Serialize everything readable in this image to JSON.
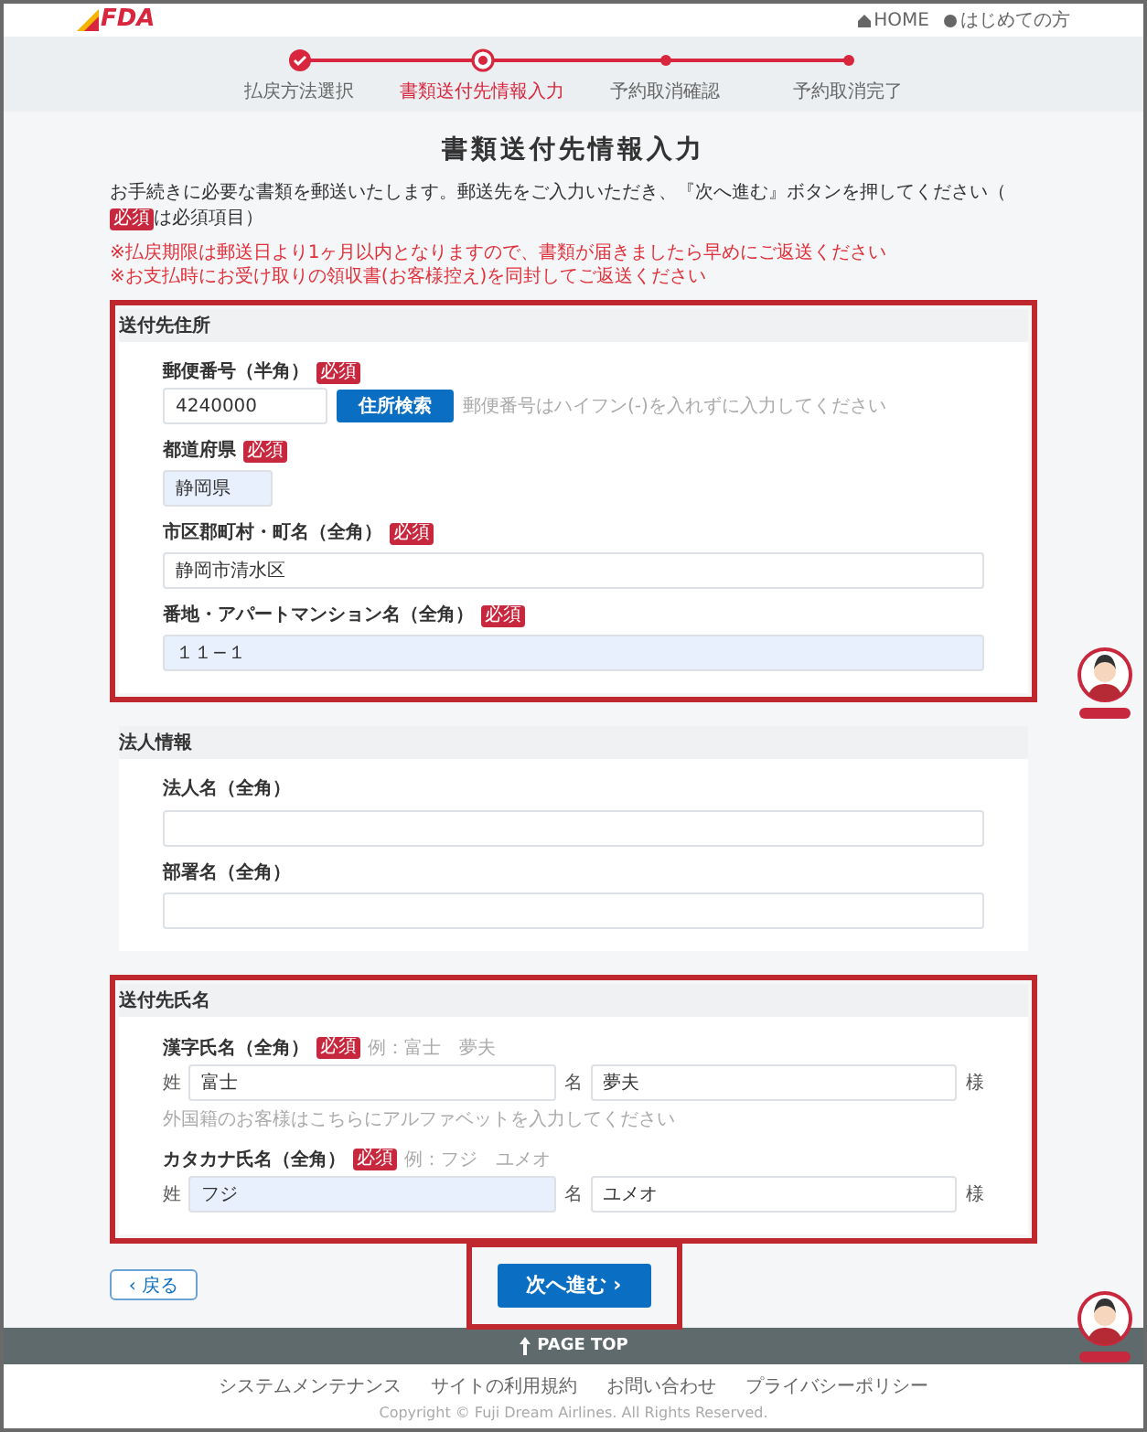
{
  "header": {
    "logo": "FDA",
    "links": [
      {
        "kind": "home",
        "label": "HOME"
      },
      {
        "kind": "guide",
        "label": "はじめての方"
      }
    ]
  },
  "steps": [
    {
      "label": "払戻方法選択",
      "completed": true,
      "selected": false
    },
    {
      "label": "書類送付先情報入力",
      "completed": false,
      "selected": true
    },
    {
      "label": "予約取消確認",
      "completed": false,
      "selected": false
    },
    {
      "label": "予約取消完了",
      "completed": false,
      "selected": false
    }
  ],
  "title": "書類送付先情報入力",
  "intro": {
    "before": "お手続きに必要な書類を郵送いたします。郵送先をご入力いただき、『次へ進む』ボタンを押してください（",
    "badge": "必須",
    "after": "は必須項目）"
  },
  "notes": [
    "※払戻期限は郵送日より1ヶ月以内となりますので、書類が届きましたら早めにご返送ください",
    "※お支払時にお受け取りの領収書(お客様控え)を同封してご返送ください"
  ],
  "sections": [
    {
      "title": "送付先住所",
      "highlighted": true,
      "fields": [
        {
          "kind": "postal",
          "label": "郵便番号（半角）",
          "required": "必須",
          "value": "4240000",
          "autofilled": false,
          "button": "住所検索",
          "hint": "郵便番号はハイフン(-)を入れずに入力してください"
        },
        {
          "kind": "short",
          "label": "都道府県",
          "required": "必須",
          "value": "静岡県",
          "autofilled": true
        },
        {
          "kind": "text",
          "label": "市区郡町村・町名（全角）",
          "required": "必須",
          "value": "静岡市清水区",
          "autofilled": false
        },
        {
          "kind": "text",
          "label": "番地・アパートマンション名（全角）",
          "required": "必須",
          "value": "１１−１",
          "autofilled": true
        }
      ]
    },
    {
      "title": "法人情報",
      "highlighted": false,
      "fields": [
        {
          "kind": "text",
          "label": "法人名（全角）",
          "autofilled": false
        },
        {
          "kind": "text",
          "label": "部署名（全角）",
          "autofilled": false
        }
      ]
    },
    {
      "title": "送付先氏名",
      "highlighted": true,
      "fields": [
        {
          "kind": "name",
          "label": "漢字氏名（全角）",
          "required": "必須",
          "example": "例：富士　夢夫",
          "parts": [
            {
              "prefix": "姓",
              "value": "富士",
              "autofilled": false
            },
            {
              "prefix": "名",
              "value": "夢夫",
              "autofilled": false
            }
          ],
          "suffix": "様",
          "hint": "外国籍のお客様はこちらにアルファベットを入力してください"
        },
        {
          "kind": "name",
          "label": "カタカナ氏名（全角）",
          "required": "必須",
          "example": "例：フジ　ユメオ",
          "parts": [
            {
              "prefix": "姓",
              "value": "フジ",
              "autofilled": true
            },
            {
              "prefix": "名",
              "value": "ユメオ",
              "autofilled": false
            }
          ],
          "suffix": "様"
        }
      ]
    }
  ],
  "buttons": {
    "back": "‹ 戻る",
    "next": "次へ進む ›",
    "next_highlighted": true
  },
  "footer": {
    "page_top": "PAGE TOP",
    "links": [
      "システムメンテナンス",
      "サイトの利用規約",
      "お問い合わせ",
      "プライバシーポリシー"
    ],
    "copyright": "Copyright © Fuji Dream Airlines. All Rights Reserved."
  }
}
